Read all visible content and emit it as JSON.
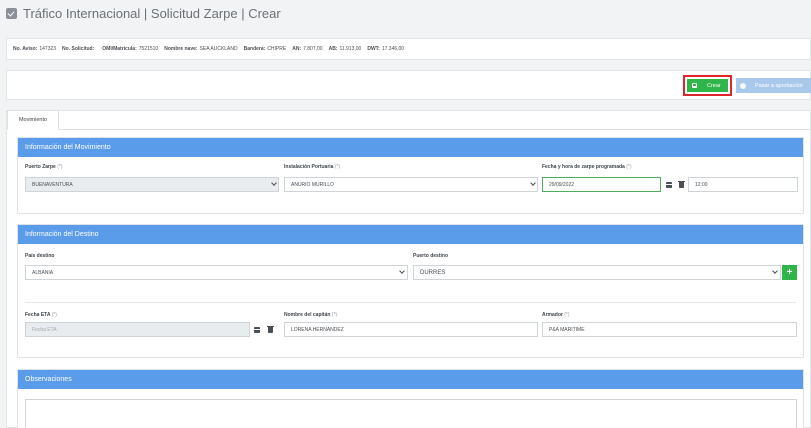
{
  "header": {
    "title": "Tráfico Internacional | Solicitud Zarpe | Crear",
    "icon": "check-square-icon"
  },
  "info_bar": [
    {
      "label": "No. Aviso:",
      "value": "147323"
    },
    {
      "label": "No. Solicitud:",
      "value": ""
    },
    {
      "label": "OMI/Matrícula:",
      "value": "7521510"
    },
    {
      "label": "Nombre nave:",
      "value": "SEA AUCKLAND"
    },
    {
      "label": "Bandera:",
      "value": "CHIPRE"
    },
    {
      "label": "AN:",
      "value": "7.807,00"
    },
    {
      "label": "AB:",
      "value": "11.913,00"
    },
    {
      "label": "DWT:",
      "value": "17.346,00"
    }
  ],
  "actions": {
    "crear_label": "Crear",
    "aprobacion_label": "Pasar a aprobación"
  },
  "tabs": [
    {
      "label": "Movimiento"
    }
  ],
  "movimiento": {
    "title": "Información del Movimiento",
    "puerto_zarpe": {
      "label": "Puerto Zarpe",
      "req": "(*)",
      "value": "BUENAVENTURA"
    },
    "instalacion": {
      "label": "Instalación Portuaria",
      "req": "(*)",
      "value": "ANURIO MURILLO"
    },
    "fecha_zarpe": {
      "label": "Fecha y hora de zarpe programada",
      "req": "(*)",
      "date": "29/09/2022",
      "time": "12:00"
    }
  },
  "destino": {
    "title": "Información del Destino",
    "pais": {
      "label": "País destino",
      "value": "ALBANIA"
    },
    "puerto": {
      "label": "Puerto destino",
      "value": "DURRES"
    },
    "fecha_eta": {
      "label": "Fecha ETA",
      "req": "(*)",
      "placeholder": "Fecha ETA"
    },
    "capitan": {
      "label": "Nombre del capitán",
      "req": "(*)",
      "value": "LORENA HERNANDEZ"
    },
    "armador": {
      "label": "Armador",
      "req": "(*)",
      "value": "P&A MARITIME"
    }
  },
  "observaciones": {
    "title": "Observaciones"
  },
  "colors": {
    "accent": "#5a9bea",
    "success": "#2fb54a",
    "highlight": "#e0242b"
  }
}
